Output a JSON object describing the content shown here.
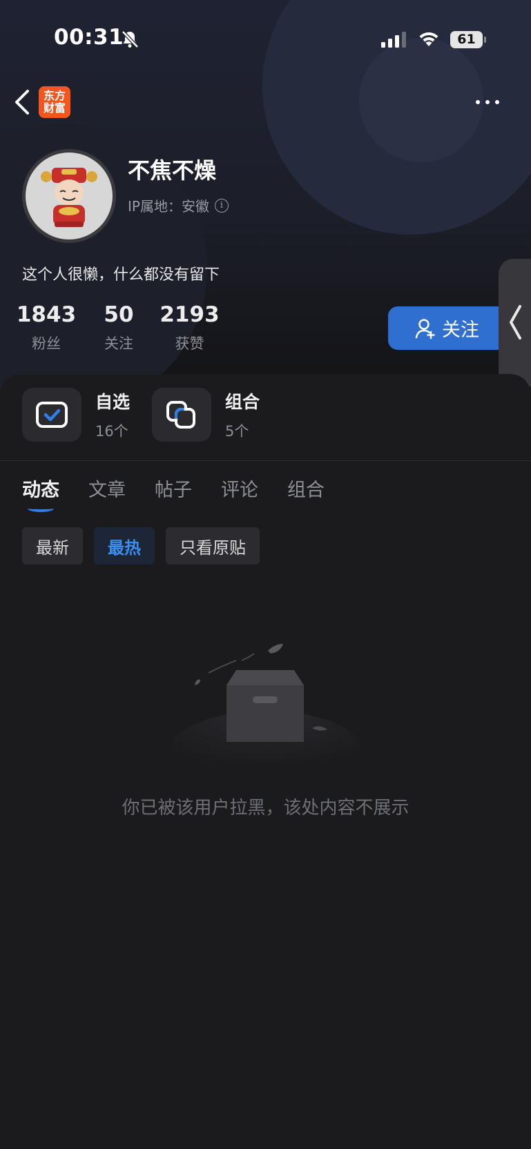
{
  "status_bar": {
    "time": "00:31",
    "battery": "61"
  },
  "nav": {
    "brand_line1": "东方",
    "brand_line2": "财富"
  },
  "profile": {
    "name": "不焦不燥",
    "ip_location": "IP属地：安徽",
    "info_glyph": "i",
    "bio": "这个人很懒，什么都没有留下",
    "stats": [
      {
        "value": "1843",
        "label": "粉丝"
      },
      {
        "value": "50",
        "label": "关注"
      },
      {
        "value": "2193",
        "label": "获赞"
      }
    ],
    "follow_label": "关注"
  },
  "quick_access": [
    {
      "label": "自选",
      "count": "16个",
      "icon": "checkbox-icon"
    },
    {
      "label": "组合",
      "count": "5个",
      "icon": "portfolio-icon"
    }
  ],
  "tabs": [
    "动态",
    "文章",
    "帖子",
    "评论",
    "组合"
  ],
  "active_tab": "动态",
  "filters": [
    "最新",
    "最热",
    "只看原贴"
  ],
  "active_filter": "最热",
  "empty_message": "你已被该用户拉黑，该处内容不展示",
  "colors": {
    "accent": "#2e6fcf",
    "brand": "#f2561d",
    "background": "#19191c"
  }
}
